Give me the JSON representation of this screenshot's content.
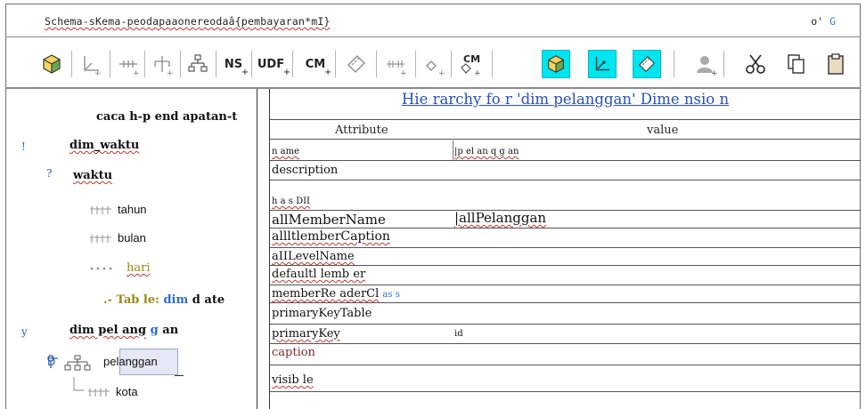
{
  "window": {
    "title": "Schema-sKema-peodapaaonereodaâ{pembayaran*mI}",
    "title_right_prefix": "o'",
    "title_right_suffix": "G"
  },
  "toolbar": {
    "ns_label": "NS",
    "udf_label": "UDF",
    "cm_label": "CM",
    "cm2_label": "CM",
    "plus": "+"
  },
  "tree": {
    "root_label": "caca h-p end apatan-t",
    "dim_waktu": {
      "label": "dim_waktu",
      "marker": "!",
      "hierarchy_marker": "?",
      "hierarchy": "waktu",
      "levels": [
        "tahun",
        "bulan",
        "hari"
      ]
    },
    "table_label_prefix": ".- Tab le:",
    "table_label_name": "dim",
    "table_label_suffix": "d ate",
    "dim_pelanggan": {
      "marker": "y",
      "label_a": "dim pel ang",
      "label_b": "g",
      "label_c": "an",
      "hierarchy": "pelanggan",
      "levels": [
        "kota"
      ]
    }
  },
  "properties": {
    "heading": "Hie rarchy fo r 'dim pelanggan' Dime nsio n",
    "columns": {
      "attribute": "Attribute",
      "value": "value"
    },
    "rows": [
      {
        "name": "n ame",
        "value": "|p el an q g an"
      },
      {
        "name": "description",
        "value": ""
      },
      {
        "name": "h a s DII",
        "value": ""
      },
      {
        "name": "allMemberName",
        "value": "|allPelanggan"
      },
      {
        "name": "allltlemberCaption",
        "value": ""
      },
      {
        "name": "aIILevelName",
        "value": ""
      },
      {
        "name": "defaultl lemb er",
        "value": ""
      },
      {
        "name": "memberRe aderCl",
        "name_suffix": "as s",
        "value": ""
      },
      {
        "name": "primaryKeyTable",
        "value": ""
      },
      {
        "name": "primaryKey",
        "value": "id"
      },
      {
        "name": "caption",
        "value": ""
      },
      {
        "name": "visib le",
        "value": ""
      }
    ]
  },
  "colors": {
    "accent_cyan": "#00e5ee",
    "link_blue": "#2d6fd6",
    "heading_blue": "#2a50b8",
    "olive": "#9b8a17"
  }
}
